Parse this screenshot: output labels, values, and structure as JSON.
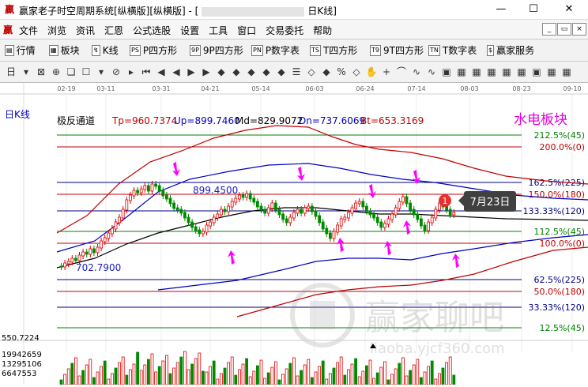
{
  "window": {
    "app_icon": "贏",
    "title_prefix": "赢家老子时空周期系统[纵横版][纵横版] - [",
    "title_suffix": "日K线]",
    "min": "—",
    "max": "☐",
    "close": "✕"
  },
  "menu": {
    "items": [
      "文件",
      "浏览",
      "资讯",
      "汇恩",
      "公式选股",
      "设置",
      "工具",
      "窗口",
      "交易委托",
      "帮助"
    ],
    "mdi": [
      "_",
      "▭",
      "×"
    ]
  },
  "toolbar1": {
    "items": [
      {
        "icon": "▤",
        "label": "行情"
      },
      {
        "icon": "▦",
        "label": "板块"
      },
      {
        "icon": "↯",
        "label": "K线"
      },
      {
        "icon": "PS",
        "label": "P四方形"
      },
      {
        "icon": "9P",
        "label": "9P四方形"
      },
      {
        "icon": "PN",
        "label": "P数字表"
      },
      {
        "icon": "TS",
        "label": "T四方形"
      },
      {
        "icon": "T9",
        "label": "9T四方形"
      },
      {
        "icon": "TN",
        "label": "T数字表"
      },
      {
        "icon": "$",
        "label": "赢家服务"
      }
    ]
  },
  "toolbar2": {
    "icons": [
      "日",
      "▾",
      "⊠",
      "⊕",
      "❏",
      "☐",
      "▾",
      "⊘",
      "▸",
      "⏮",
      "◀",
      "◀",
      "▶",
      "▶",
      "◆",
      "◆",
      "◆",
      "◆",
      "◆",
      "☰",
      "◇",
      "◆",
      "%",
      "◇",
      "✋",
      "+",
      "⌒",
      "∿",
      "∿",
      "▣",
      "▦",
      "▦",
      "▦",
      "▦",
      "▦",
      "▣",
      "▦",
      "▦"
    ]
  },
  "chart": {
    "period_label": "日K线",
    "indicator_name": "极反通道",
    "tp": "Tp=960.7374",
    "up": "Up=899.7460",
    "md": "Md=829.9072",
    "dn": "Dn=737.6069",
    "bt": "Bt=653.3169",
    "sector_label": "水电板块",
    "high_marker": "899.4500",
    "low_marker": "702.7900",
    "callout_badge": "1",
    "callout_date": "7月23日",
    "x_ticks": [
      "02-19",
      "03-11",
      "03-31",
      "04-21",
      "05-14",
      "06-03",
      "06-24",
      "07-14",
      "08-03",
      "08-23",
      "09-10"
    ],
    "levels": [
      {
        "label": "212.5%(45)",
        "color": "#008000"
      },
      {
        "label": "200.0%(0)",
        "color": "#c00000"
      },
      {
        "label": "162.5%(225)",
        "color": "#000080"
      },
      {
        "label": "150.0%(180)",
        "color": "#c00000"
      },
      {
        "label": "133.33%(120)",
        "color": "#000080"
      },
      {
        "label": "112.5%(45)",
        "color": "#008000"
      },
      {
        "label": "100.0%(0)",
        "color": "#c00000"
      },
      {
        "label": "62.5%(225)",
        "color": "#000080"
      },
      {
        "label": "50.0%(180)",
        "color": "#c00000"
      },
      {
        "label": "33.33%(120)",
        "color": "#000080"
      },
      {
        "label": "12.5%(45)",
        "color": "#008000"
      }
    ],
    "left_values": [
      "550.7224",
      "19942659",
      "13295106",
      "6647553"
    ],
    "watermark_main": "赢家聊吧",
    "watermark_sub": "liaoba.yjcf360.com"
  }
}
